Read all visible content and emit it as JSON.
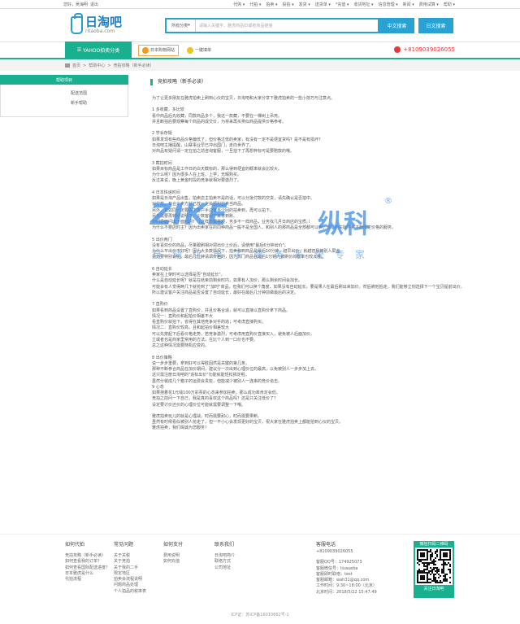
{
  "topbar": {
    "greeting": "您好，吴海明",
    "logout": "退出",
    "links": [
      "代购",
      "代拍",
      "拍卖",
      "投拍",
      "发货",
      "送货单",
      "*充值",
      "收货地址",
      "信息管理",
      "新闻",
      "费用试算",
      "帮助"
    ]
  },
  "logo": {
    "cn": "日淘吧",
    "en": "ritaoba.com"
  },
  "search": {
    "category": "所有分类",
    "placeholder": "请输入关键字、雅虎商品ID或者商品链接",
    "cn_button": "中文搜索",
    "jp_button": "日文搜索"
  },
  "nav": {
    "yahoo": "YAHOO拍卖分类",
    "item1": "日本购物网站",
    "item2": "一键填单",
    "phone": "+8109039026055"
  },
  "breadcrumb": [
    "首页",
    "帮助中心",
    "竞拍攻略（新手必读）"
  ],
  "sidebar": {
    "title": "帮助项目",
    "items": [
      "配送范围",
      "新手帮助"
    ]
  },
  "article": {
    "title": "竞拍攻略（新手必读）",
    "paragraphs": [
      [
        "为了让更多朋友在雅虎拍卖上刷到心仪的宝贝，日淘吧和大家分享下雅虎拍卖的一些小技巧与注意点。"
      ],
      [
        "1  多收藏，多比较",
        "看中商品后先收藏，同款商品多个，我这一款藏，不要在一棵树上吊死。",
        "并且断拍后要观察每个商品的成交价，为将来再买类似商品提供价格参考。"
      ],
      [
        "2  学会存疑",
        "如果发现有些商品价格偏低了，但价格过低的卖家，有没有一定不是便宜货吗？是不是有损坏？",
        "日淘吧主播提醒，山寨事业早已冲出国门，走向世界了。",
        "对商品有疑问请一定在拍之前咨询客服，一旦拍下了再想弃标可是要赔款的哦。"
      ],
      [
        "3  截拍时间",
        "如果目标商品是工作日的白天截标的，那么得到便宜的概率就会比较大。",
        "为什么呢？因为很多人在上班、上学，无暇购买。",
        "反过来说，晚上黄金时段的竞争就相对要激烈了。"
      ],
      [
        "4  日本快递时间",
        "如果是日淘产品出售，拍卖店主拍卖不是的话，可以分批付款的交货，请先确认是否拍中。",
        "对付款，有合个卖方就已放一定会顺利拍卖当商品。",
        "另外，其如同一定要看下客户手边有多少回的拍卖到，再可以拍下。",
        "另外需要再特别说明下，少数客服下来将到账。",
        "中间场面问出下面时间？（这样不要事项，务多不一样商品，业务找几月日商店的宝质。）",
        "为什么不要店时主？因为出卖家在的同种商品一般不是全国人，和别人的那商品是全部都可以卖，部门的实际件量下到限定价格的服务。"
      ],
      [
        "5  出价两门",
        "没有喜欢价的商品，尽量跟刷相对把出价上价后，请使用\"最后6分钟出价\"。",
        "为什么平出价不好呢？因为大多数情况下，拍卖和到商品是最后10分钟，越早出价，就越容易被别人屏盖。",
        "另外要特别说明，最后几分钟请调价格的，因为热门商品在最后1分钟内被刷价的概率也较大哦。"
      ],
      [
        "6  自动延长",
        "卖家在上架时可以选择是否\"自动延长\"。",
        "什么是自动延长呢？就是在结束前剩余时内，如果有人加价，那么剩余时间会加长。",
        "可能会有人觉得两几下就抢到了\"加时\"商品，但我们可以换个角度，如果没有自动延长，要是果人在最后刷出来加价，然后被他拍走。我们能够立刻选择下一个宝贝提前出价。",
        "所以建议客户关注商品是否设置了自动延长，最好在最后几分钟前做最后的决定。"
      ],
      [
        "7  直购价",
        "如果看到商品设置了直购价，并且价格合适，就可以直接以直购价拿下商品。",
        "情况一：直购价和起拍价相差不大",
        "看直购价就拍下，省得在其他竞争对手的追；可考虑直接购买。",
        "情况二：直购价较高，且和起拍价相差较大",
        "可以先按起下后看价格走势，若竞争激烈，可考虑用直购价直接买入，避免被人后面加价。",
        "立或者也是商家里常用的方法，在比个人到一口价也不要。",
        "总之这种情况需要随机应变的。"
      ],
      [
        "8  出价策略",
        "说一步步重要，拿到好可以得胜固然是关键的第几条。",
        "那种不断参合商品在加价期间，建议分一次出到心理价位的最高，以免被别人一步步加上去。",
        "这只需注册日淘吧的\"追标出价\"功能就能轻松搞定啦。",
        "虽然分装成几个箱子的运费会贵些，但能减少被别人一连串的竞价追击。",
        "9  心态",
        "如果抱着花1元钱100万彩票的心态来参加拍卖，那么成功率肯定会低。",
        "竞拍之前问一下自己，我是真的喜欢这个商品吗？还是只关注低价了？",
        "设定要讨价还价的心理价位可能就需要调整一下哦。"
      ],
      [
        "雅虎拍卖玩儿的就是心理战，时而需要耐心，时而需要果断。",
        "虽然有时候看似被别人抢走了，但一不小心会发现更好的宝贝，祝大家在雅虎拍卖上都能拍到心仪的宝贝。",
        "雅虎拍卖，我们竭诚为您服务！"
      ]
    ]
  },
  "watermark": {
    "logo": "ZIKE",
    "cn": "纵科",
    "sub": "自动化电子商务系统专家"
  },
  "footer": {
    "cols": [
      {
        "title": "如何代拍",
        "items": [
          "竞拍攻略（新手必读）",
          "如何查看我的订单？",
          "如何查看国际配送进度？",
          "日本雅虎是什么",
          "代拍流程"
        ]
      },
      {
        "title": "常见问题",
        "items": [
          "关于关税",
          "关于竞拍",
          "关于我的二手",
          "限定地区",
          "拍卖会流程说明",
          "问题商品处理",
          "个人拍品的税率表"
        ]
      },
      {
        "title": "如何支付",
        "items": [
          "费用说明",
          "如何充值"
        ]
      },
      {
        "title": "联系我们",
        "items": [
          "日淘吧简介",
          "联络方式",
          "公司地址"
        ]
      }
    ],
    "contact": {
      "title": "客服电话",
      "phone": "+8109039026055",
      "lines": [
        "客服QQ号：174925073",
        "客服微信号：liuaueba",
        "客服即时联络：test",
        "客服邮箱：wah31@qq.com",
        "工作时间：9:30~18:00（北京）",
        "北京时间：2018/5/22 15:47:49"
      ]
    },
    "qr": {
      "top": "微信扫码二维码",
      "bottom": "关注日淘吧"
    }
  },
  "copyright": "ICP证：苏ICP备16010862号-1"
}
